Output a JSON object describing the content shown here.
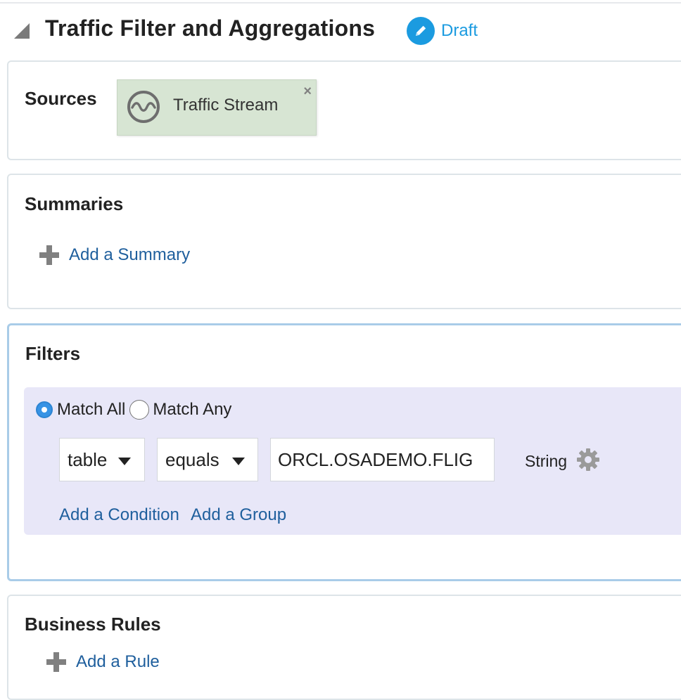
{
  "header": {
    "title": "Traffic Filter and Aggregations",
    "status": "Draft"
  },
  "sources": {
    "title": "Sources",
    "items": [
      {
        "label": "Traffic Stream",
        "remove": "×"
      }
    ]
  },
  "summaries": {
    "title": "Summaries",
    "add_label": "Add a Summary"
  },
  "filters": {
    "title": "Filters",
    "match_all": "Match All",
    "match_any": "Match Any",
    "selected_match": "Match All",
    "condition": {
      "field": "table",
      "operator": "equals",
      "value": "ORCL.OSADEMO.FLIG",
      "type": "String"
    },
    "add_condition": "Add a Condition",
    "add_group": "Add a Group"
  },
  "business_rules": {
    "title": "Business Rules",
    "add_label": "Add a Rule"
  },
  "colors": {
    "accent": "#1b9be0",
    "link": "#1f5f9d",
    "source_chip": "#d7e5d3",
    "filter_bg": "#e8e7f8",
    "active_border": "#a9cce8"
  },
  "icons": {
    "collapse": "collapse-triangle-icon",
    "edit": "pencil-icon",
    "stream": "stream-wave-icon",
    "remove": "close-icon",
    "add": "plus-icon",
    "settings": "gear-icon"
  }
}
